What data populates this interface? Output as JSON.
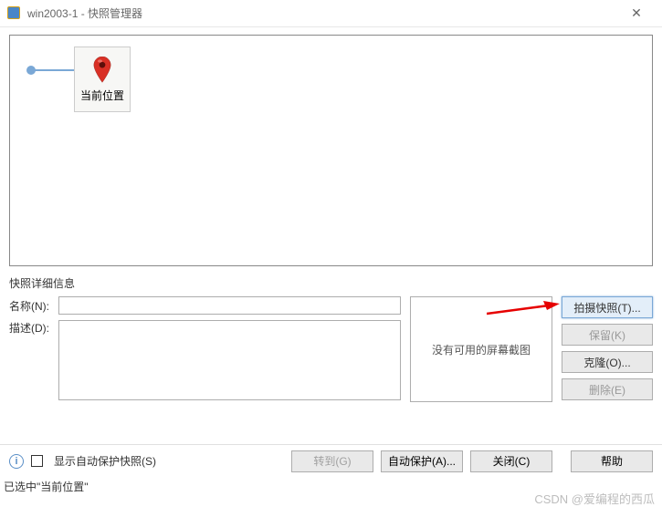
{
  "window": {
    "title": "win2003-1 - 快照管理器"
  },
  "tree": {
    "current_node_label": "当前位置"
  },
  "details": {
    "section_title": "快照详细信息",
    "name_label": "名称(N):",
    "name_value": "",
    "desc_label": "描述(D):",
    "desc_value": "",
    "preview_text": "没有可用的屏幕截图"
  },
  "right_buttons": {
    "take_snapshot": "拍摄快照(T)...",
    "keep": "保留(K)",
    "clone": "克隆(O)...",
    "delete": "删除(E)"
  },
  "bottom": {
    "autoprotect_checkbox_label": "显示自动保护快照(S)",
    "goto": "转到(G)",
    "autoprotect": "自动保护(A)...",
    "close": "关闭(C)",
    "help": "帮助"
  },
  "status": {
    "text": "已选中\"当前位置\""
  },
  "watermark": "CSDN @爱编程的西瓜"
}
